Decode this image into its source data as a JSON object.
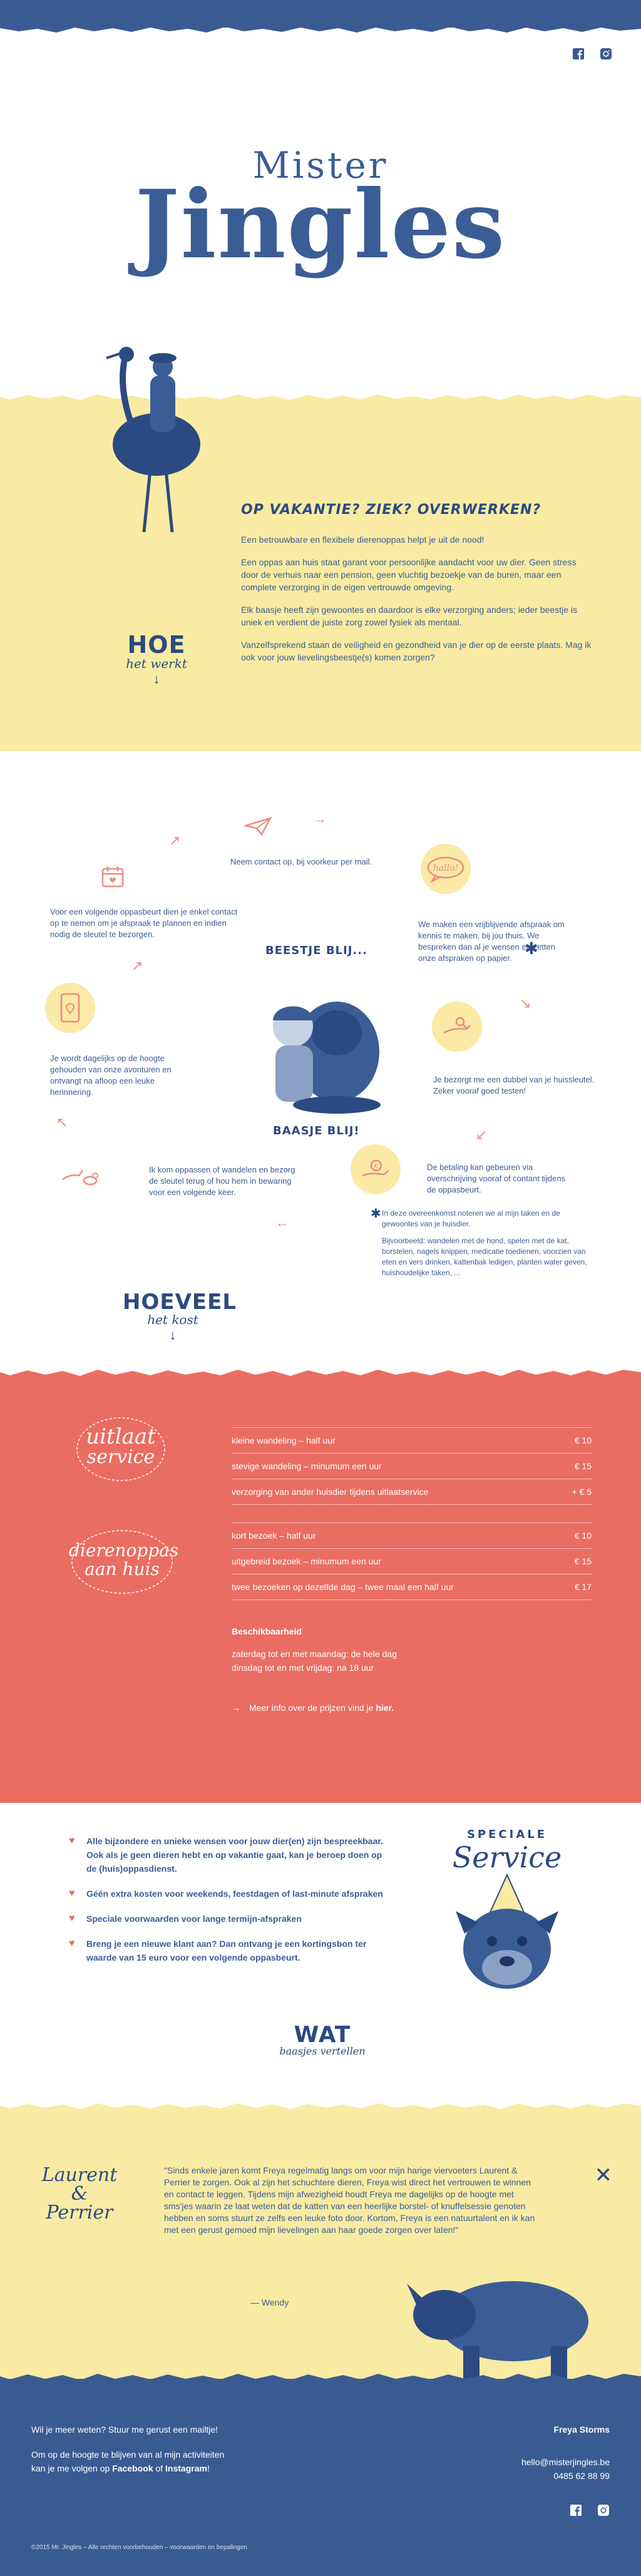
{
  "header": {
    "logo_top": "Mister",
    "logo_bottom": "Jingles",
    "social": [
      "facebook-icon",
      "instagram-icon"
    ]
  },
  "intro": {
    "title": "OP VAKANTIE? ZIEK? OVERWERKEN?",
    "paragraphs": [
      "Een betrouwbare en flexibele dierenoppas helpt je uit de nood!",
      "Een oppas aan huis staat garant voor persoonlijke aandacht voor uw dier. Geen stress door de verhuis naar een pension, geen vluchtig bezoekje van de buren, maar een complete verzorging in de eigen vertrouwde omgeving.",
      "Elk baasje heeft zijn gewoontes en daardoor is elke verzorging anders; ieder beestje is uniek en verdient de juiste zorg zowel fysiek als mentaal.",
      "Vanzelfsprekend staan de veiligheid en gezondheid van je dier op de eerste plaats. Mag ik ook voor jouw lievelingsbeestje(s) komen zorgen?"
    ],
    "hoe_big": "HOE",
    "hoe_small": "het werkt"
  },
  "cycle": {
    "steps": [
      "Neem contact op, bij voorkeur per mail.",
      "We maken een vrijblijvende afspraak om kennis te maken, bij jou thuis. We bespreken dan al je wensen en zetten onze afspraken op papier.",
      "Je bezorgt me een dubbel van je huissleutel. Zeker vooraf goed testen!",
      "De betaling kan gebeuren via overschrijving vooraf of contant tijdens de oppasbeurt.",
      "Ik kom oppassen of wandelen en bezorg de sleutel terug of hou hem in bewaring voor een volgende keer.",
      "Je wordt dagelijks op de hoogte gehouden van onze avonturen en ontvangt na afloop een leuke herinnering.",
      "Voor een volgende oppasbeurt dien je enkel contact op te nemen om je afspraak te plannen en indien nodig de sleutel te bezorgen."
    ],
    "center_top": "BEESTJE BLIJ...",
    "center_bottom": "BAASJE BLIJ!",
    "note_p1": "In deze overeenkomst noteren we al mijn taken en de gewoontes van je huisdier.",
    "note_p2": "Bijvoorbeeld: wandelen met de hond, spelen met de kat, borstelen, nagels knippen, medicatie toedienen, voorzien van eten en vers drinken, kattenbak ledigen, planten water geven, huishoudelijke taken, ...",
    "hoeveel_big": "HOEVEEL",
    "hoeveel_small": "het kost",
    "hallo": "hallo!"
  },
  "prices": {
    "badge1_line1": "uitlaat",
    "badge1_line2": "service",
    "badge2_line1": "dierenoppas",
    "badge2_line2": "aan huis",
    "walk_rows": [
      {
        "label": "kleine wandeling – half uur",
        "price": "€ 10"
      },
      {
        "label": "stevige wandeling – minumum een uur",
        "price": "€ 15"
      },
      {
        "label": "verzorging van ander huisdier tijdens uitlaatservice",
        "price": "+ € 5"
      }
    ],
    "visit_rows": [
      {
        "label": "kort bezoek – half uur",
        "price": "€ 10"
      },
      {
        "label": "uitgebreid bezoek – minumum een uur",
        "price": "€ 15"
      },
      {
        "label": "twee bezoeken op dezelfde dag – twee maal een half uur",
        "price": "€ 17"
      }
    ],
    "availability_title": "Beschikbaarheid",
    "availability_line1": "zaterdag tot en met maandag: de hele dag",
    "availability_line2": "dinsdag tot en met vrijdag: na 18 uur",
    "more_info": "Meer info over de prijzen vind je",
    "more_info_link": "hier."
  },
  "special": {
    "bullets": [
      "Alle bijzondere en unieke wensen voor jouw dier(en) zijn bespreekbaar. Ook als je geen dieren hebt en op vakantie gaat, kan je beroep doen op de (huis)oppasdienst.",
      "Géén extra kosten voor weekends, feestdagen of last-minute afspraken",
      "Speciale voorwaarden voor lange termijn-afspraken",
      "Breng je een nieuwe klant aan? Dan ontvang je een kortingsbon ter waarde van 15 euro voor een volgende oppasbeurt."
    ],
    "badge_top": "SPECIALE",
    "badge_bottom": "Service",
    "wat_big": "WAT",
    "wat_small": "baasjes vertellen"
  },
  "testimonial": {
    "names_line1": "Laurent",
    "names_line2": "&",
    "names_line3": "Perrier",
    "quote": "\"Sinds enkele jaren komt Freya regelmatig langs om voor mijn harige viervoeters Laurent & Perrier te zorgen. Ook al zijn het schuchtere dieren, Freya wist direct het vertrouwen te winnen en contact te leggen. Tijdens mijn afwezigheid houdt Freya me dagelijks op de hoogte met sms'jes waarin ze laat weten dat de katten van een heerlijke borstel- of knuffelsessie genoten hebben en soms stuurt ze zelfs een leuke foto door. Kortom, Freya is een natuurtalent en ik kan met een gerust gemoed mijn lievelingen aan haar goede zorgen over laten!\"",
    "author": "— Wendy"
  },
  "footer": {
    "line1": "Wil je meer weten? Stuur me gerust een mailtje!",
    "line2_a": "Om op de hoogte te blijven van al mijn activiteiten",
    "line2_b_pre": "kan je me volgen op ",
    "facebook": "Facebook",
    "of": " of ",
    "instagram": "Instagram",
    "excl": "!",
    "name": "Freya Storms",
    "email": "hello@misterjingles.be",
    "phone": "0485 62 88 99",
    "copyright": "©2015 Mr. Jingles – Alle rechten voorbehouden – voorwaarden en bepalingen"
  },
  "colors": {
    "navy": "#3a5b92",
    "yellow": "#f9eba3",
    "coral": "#ea6d62"
  }
}
